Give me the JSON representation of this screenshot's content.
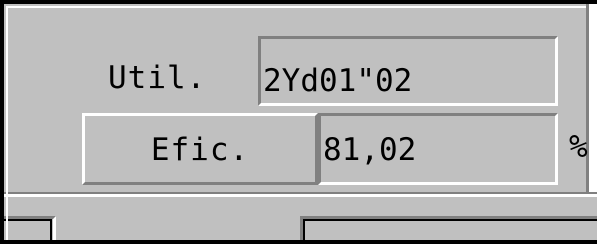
{
  "form": {
    "util_label": "Util.",
    "util_value": "2Yd01\"02",
    "efic_button_label": "Efic.",
    "efic_value": "81,02",
    "efic_unit": "%"
  },
  "colors": {
    "face": "#c0c0c0",
    "highlight": "#ffffff",
    "shadow": "#808080",
    "outline": "#000000"
  }
}
